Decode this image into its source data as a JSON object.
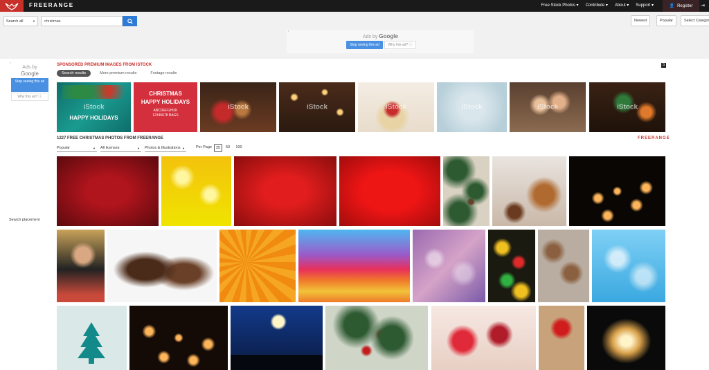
{
  "nav": {
    "brand": "FREERANGE",
    "links": [
      "Free Stock Photos ▾",
      "Contribute ▾",
      "About ▾",
      "Support ▾"
    ],
    "register": "Register"
  },
  "search": {
    "scope": "Search all",
    "value": "christmas"
  },
  "sort": {
    "newest": "Newest",
    "popular": "Popular",
    "category": "Select Category"
  },
  "ad_top": {
    "ads_by": "Ads by",
    "google": "Google",
    "stop": "Stop seeing this ad",
    "why": "Why this ad? ⓘ"
  },
  "ad_left": {
    "ads_by": "Ads by",
    "google": "Google",
    "stop": "Stop seeing this ad",
    "why": "Why this ad? ⓘ",
    "placement": "Search placement"
  },
  "sponsored": {
    "title": "SPONSORED PREMIUM IMAGES FROM ISTOCK",
    "logo": "S",
    "tabs": [
      "Search results",
      "More premium results",
      "Footage results"
    ],
    "watermark": "iStock",
    "card_text": [
      "HAPPY HOLIDAYS",
      "CHRISTMAS",
      "HAPPY HOLIDAYS",
      "ABCDEFGHIJK",
      "12345678 BAGS"
    ]
  },
  "results": {
    "title": "1227 FREE CHRISTMAS PHOTOS FROM FREERANGE",
    "brand": "FREERANGE",
    "filters": [
      "Popular",
      "All licenses",
      "Photos & Illustrations"
    ],
    "per_page_label": "Per Page",
    "per_page_options": [
      "25",
      "50",
      "100"
    ],
    "per_page_selected": "25"
  },
  "colors": {
    "brand_red": "#c8302a",
    "nav_bg": "#1a1a1a",
    "button_blue": "#2e7bd6"
  }
}
